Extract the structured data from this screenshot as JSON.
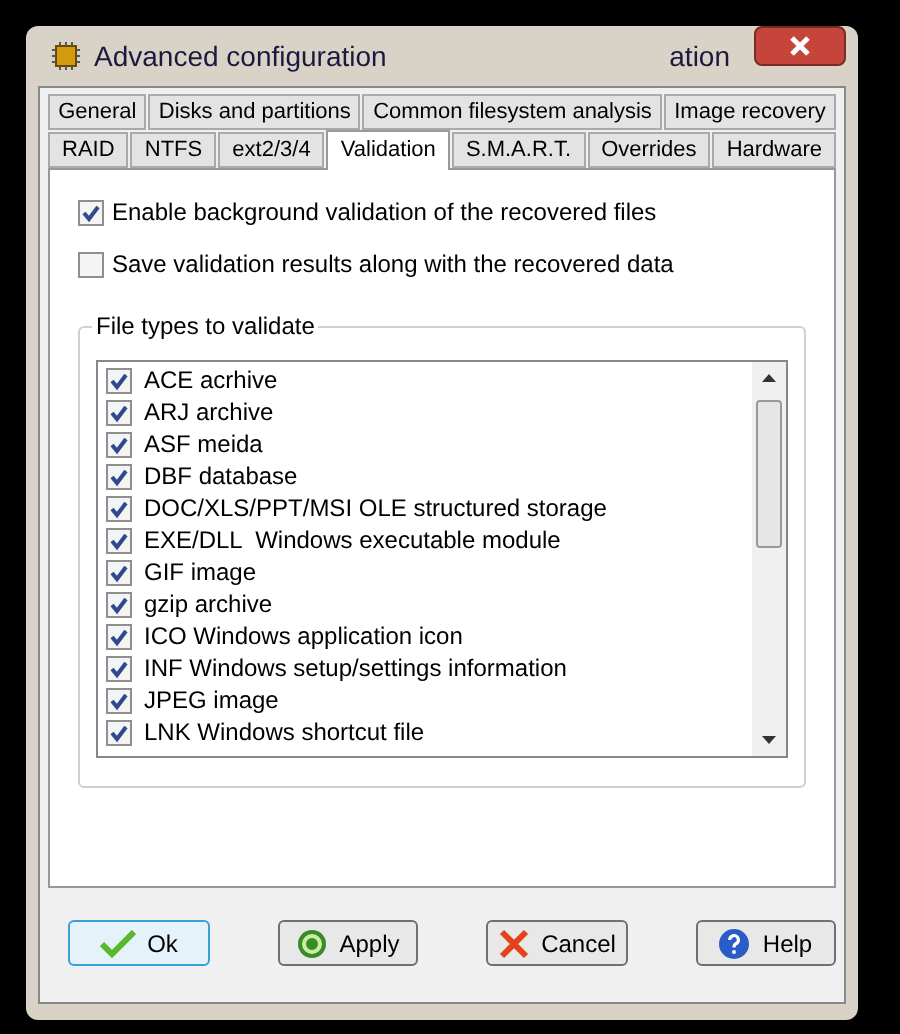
{
  "window": {
    "title": "Advanced configuration",
    "title_fragment": "ation"
  },
  "tab_rows": [
    [
      {
        "label": "General",
        "selected": false
      },
      {
        "label": "Disks and partitions",
        "selected": false
      },
      {
        "label": "Common filesystem analysis",
        "selected": false
      },
      {
        "label": "Image recovery",
        "selected": false
      }
    ],
    [
      {
        "label": "RAID",
        "selected": false
      },
      {
        "label": "NTFS",
        "selected": false
      },
      {
        "label": "ext2/3/4",
        "selected": false
      },
      {
        "label": "Validation",
        "selected": true
      },
      {
        "label": "S.M.A.R.T.",
        "selected": false
      },
      {
        "label": "Overrides",
        "selected": false
      },
      {
        "label": "Hardware",
        "selected": false
      }
    ]
  ],
  "options": [
    {
      "label": "Enable background validation of the recovered files",
      "checked": true
    },
    {
      "label": "Save validation results along with the recovered data",
      "checked": false
    }
  ],
  "group": {
    "title": "File types to validate",
    "items": [
      {
        "label": "ACE acrhive",
        "checked": true
      },
      {
        "label": "ARJ archive",
        "checked": true
      },
      {
        "label": "ASF meida",
        "checked": true
      },
      {
        "label": "DBF database",
        "checked": true
      },
      {
        "label": "DOC/XLS/PPT/MSI OLE structured storage",
        "checked": true
      },
      {
        "label": "EXE/DLL  Windows executable module",
        "checked": true
      },
      {
        "label": "GIF image",
        "checked": true
      },
      {
        "label": "gzip archive",
        "checked": true
      },
      {
        "label": "ICO Windows application icon",
        "checked": true
      },
      {
        "label": "INF Windows setup/settings information",
        "checked": true
      },
      {
        "label": "JPEG image",
        "checked": true
      },
      {
        "label": "LNK Windows shortcut file",
        "checked": true
      }
    ]
  },
  "buttons": [
    {
      "label": "Ok",
      "kind": "ok",
      "selected": true
    },
    {
      "label": "Apply",
      "kind": "apply",
      "selected": false
    },
    {
      "label": "Cancel",
      "kind": "cancel",
      "selected": false
    },
    {
      "label": "Help",
      "kind": "help",
      "selected": false
    }
  ]
}
